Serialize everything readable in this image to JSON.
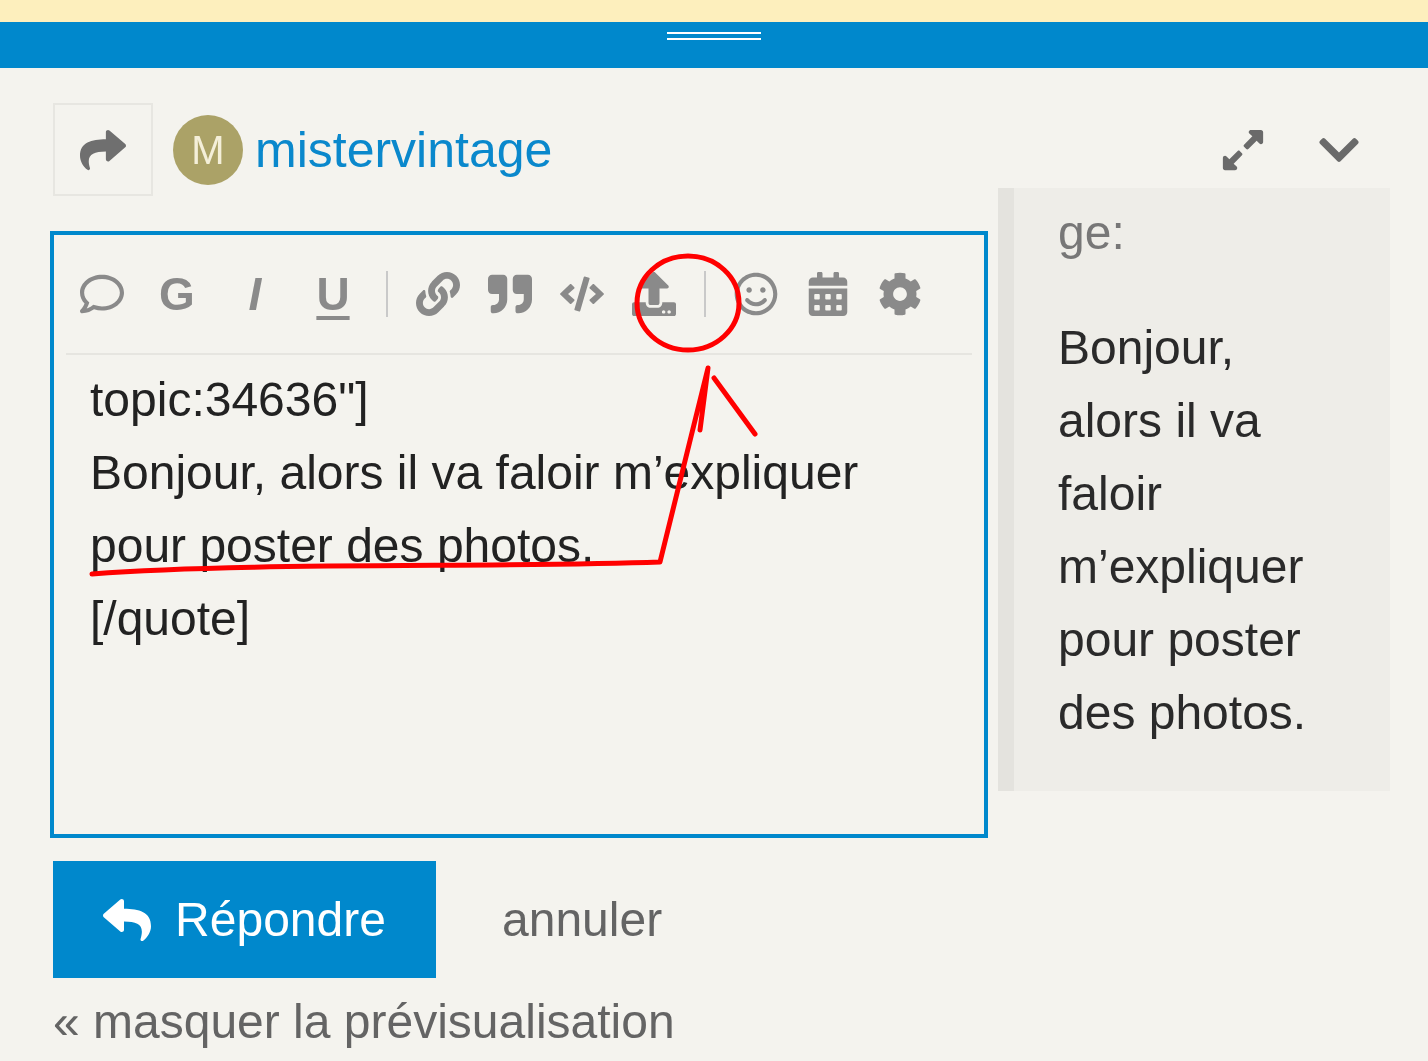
{
  "composer": {
    "avatar_letter": "M",
    "username": "mistervintage"
  },
  "toolbar_letters": [
    "G",
    "I",
    "U"
  ],
  "editor_lines": [
    "topic:34636\"]",
    "Bonjour, alors il va faloir m’expliquer",
    "pour poster des photos.",
    "[/quote]"
  ],
  "preview": {
    "cut_text": "ge:",
    "paragraph": "Bonjour, alors il va faloir m’expliquer pour poster des photos."
  },
  "reply_button": "Répondre",
  "cancel_link": "annuler",
  "hide_preview_link": "« masquer la prévisualisation"
}
